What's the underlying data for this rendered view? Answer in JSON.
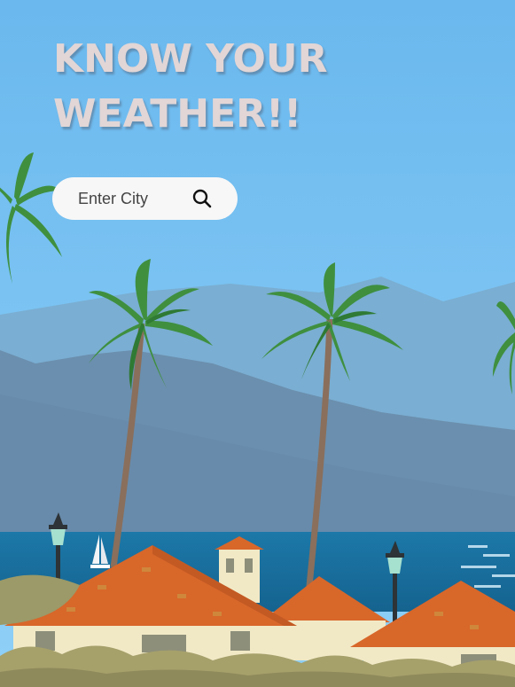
{
  "header": {
    "title_line1": "KNOW YOUR",
    "title_line2": "WEATHER!!"
  },
  "search": {
    "placeholder": "Enter City",
    "icon": "search-icon"
  },
  "colors": {
    "sky": "#74bff0",
    "title": "#e2d6d6",
    "sea": "#1d7aa6",
    "roof": "#d8672a"
  }
}
